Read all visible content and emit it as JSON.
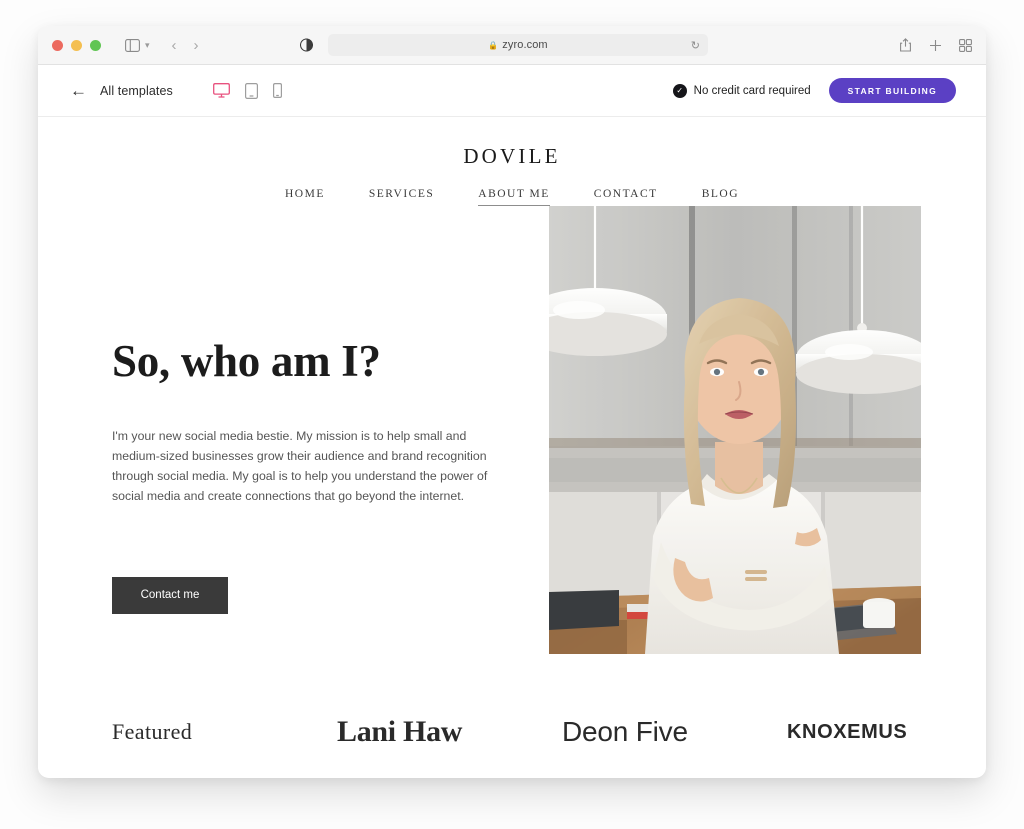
{
  "browser": {
    "url": "zyro.com",
    "lock_icon": "lock-icon",
    "reload_icon": "reload-icon",
    "sidebar_icon": "sidebar-toggle-icon",
    "chevron_icon": "chevron-down-icon",
    "back_icon": "back-arrow-icon",
    "forward_icon": "forward-arrow-icon",
    "shield_icon": "privacy-shield-icon",
    "share_icon": "share-icon",
    "new_tab_icon": "plus-icon",
    "tab_overview_icon": "tab-grid-icon",
    "traffic_lights": [
      "close-red",
      "minimize-yellow",
      "maximize-green"
    ]
  },
  "template_bar": {
    "back_label": "All templates",
    "devices": [
      {
        "name": "desktop",
        "active": true
      },
      {
        "name": "tablet",
        "active": false
      },
      {
        "name": "mobile",
        "active": false
      }
    ],
    "no_credit_card": "No credit card required",
    "check_glyph": "✓",
    "cta_label": "START BUILDING",
    "cta_color": "#5b40c4",
    "active_device_color": "#e8527f"
  },
  "site": {
    "logo": "DOVILE",
    "nav": [
      {
        "label": "HOME",
        "active": false
      },
      {
        "label": "SERVICES",
        "active": false
      },
      {
        "label": "ABOUT ME",
        "active": true
      },
      {
        "label": "CONTACT",
        "active": false
      },
      {
        "label": "BLOG",
        "active": false
      }
    ],
    "hero": {
      "title": "So, who am I?",
      "paragraph": "I'm your new social media bestie. My mission is to help small and medium-sized businesses grow their audience and brand recognition through social media. My goal is to help you understand the power of social media and create connections that go beyond the internet.",
      "button_label": "Contact me",
      "button_color": "#3a3a3a",
      "photo_alt": "Portrait of a blonde woman in white outfit with arms crossed, standing in a modern kitchen with white pendant lamps and a wooden table"
    },
    "featured": [
      {
        "name": "Featured",
        "style": "serif"
      },
      {
        "name": "Lani Haw",
        "style": "serif-bold"
      },
      {
        "name": "Deon Five",
        "style": "sans-light"
      },
      {
        "name": "KNOXEMUS",
        "style": "sans-bold"
      }
    ]
  }
}
